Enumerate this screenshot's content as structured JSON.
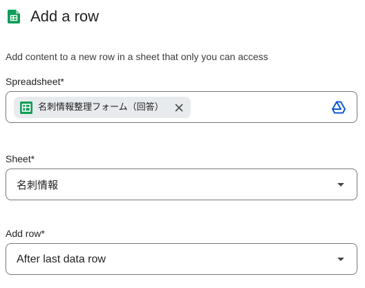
{
  "header": {
    "title": "Add a row",
    "icon": "google-sheets-icon",
    "icon_color": "#0f9d58"
  },
  "description": "Add content to a new row in a sheet that only you can access",
  "spreadsheet_field": {
    "label": "Spreadsheet*",
    "chip_label": "名刺情報整理フォーム（回答）",
    "chip_icon": "google-sheets-icon",
    "chip_close_icon": "close-icon",
    "picker_icon": "google-drive-icon",
    "accent_color": "#0b57d0"
  },
  "sheet_field": {
    "label": "Sheet*",
    "value": "名刺情報"
  },
  "add_row_field": {
    "label": "Add row*",
    "value": "After last data row"
  }
}
